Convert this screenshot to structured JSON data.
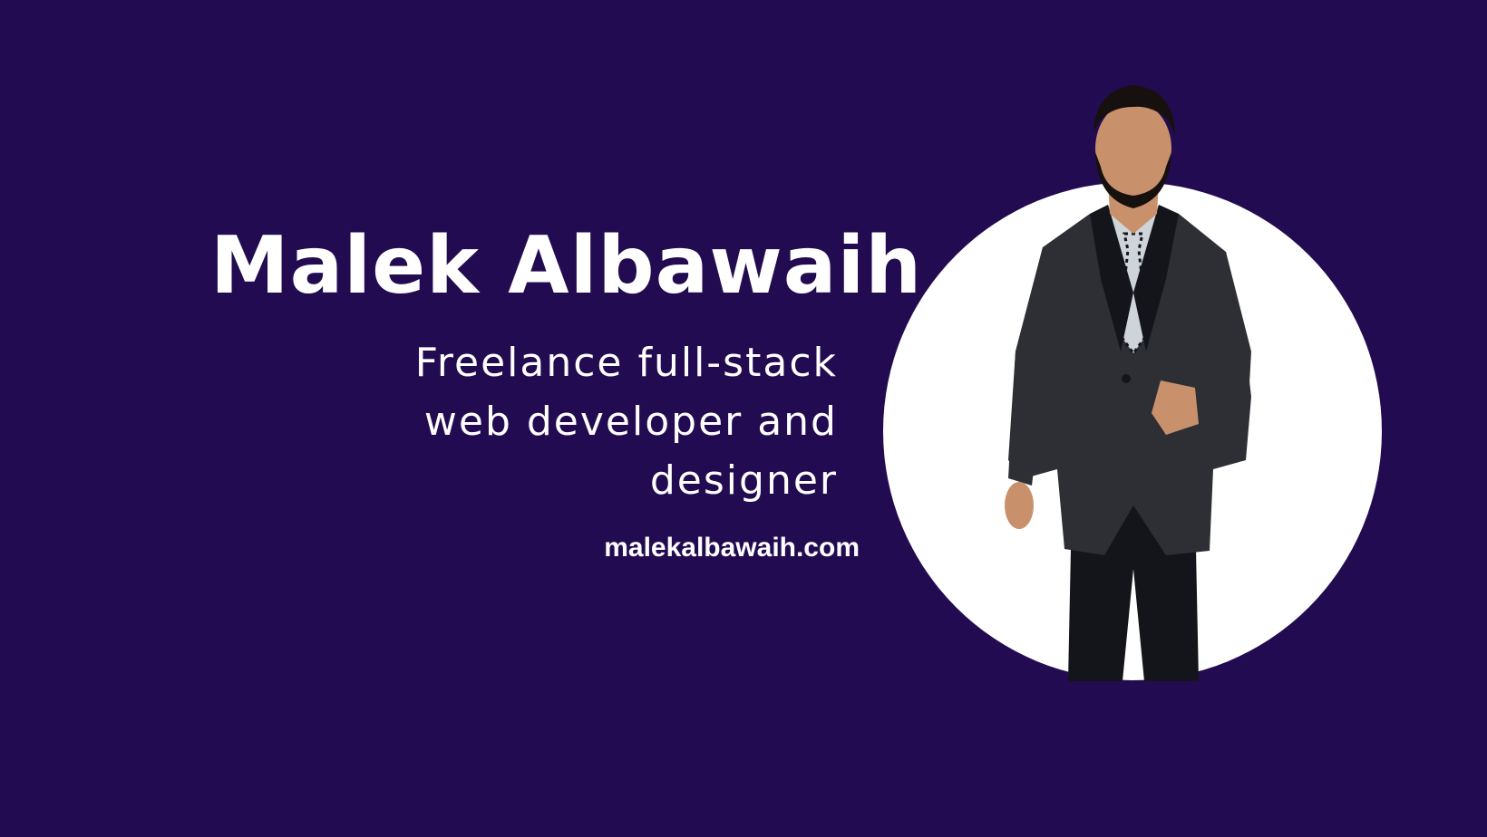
{
  "colors": {
    "background": "#220B50",
    "text": "#FFFFFF",
    "circle": "#FFFFFF",
    "suit": "#2D2F34",
    "pants": "#14151A",
    "shirt": "#CFD3DA",
    "skin": "#C9906C",
    "hair": "#16110E"
  },
  "hero": {
    "name": "Malek Albawaih",
    "tagline_lines": [
      "Freelance full-stack",
      "web developer and",
      "designer"
    ],
    "website": "malekalbawaih.com"
  },
  "photo": {
    "icon": "person-portrait-icon"
  }
}
